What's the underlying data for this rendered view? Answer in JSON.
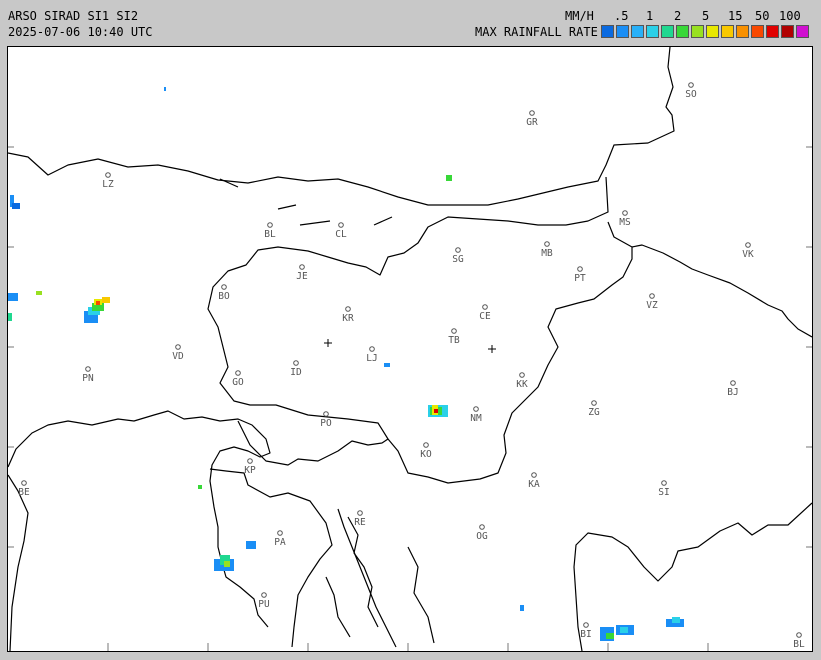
{
  "header": {
    "title": "ARSO SIRAD SI1 SI2",
    "timestamp": "2025-07-06 10:40 UTC",
    "units": "MM/H",
    "scale_title": "MAX RAINFALL RATE"
  },
  "scale": {
    "labels": [
      ".5",
      "1",
      "2",
      "5",
      "15",
      "50",
      "100"
    ],
    "colors": [
      "#0a6ae0",
      "#1a8ef5",
      "#28b0f8",
      "#2ad0e8",
      "#20d890",
      "#38d838",
      "#98e020",
      "#e8e800",
      "#f8c800",
      "#f89000",
      "#f84800",
      "#e00000",
      "#b00000",
      "#d010d0"
    ]
  },
  "cities": [
    {
      "name": "SO"
    },
    {
      "name": "GR"
    },
    {
      "name": "LZ"
    },
    {
      "name": "BL"
    },
    {
      "name": "CL"
    },
    {
      "name": "MS"
    },
    {
      "name": "MB"
    },
    {
      "name": "VK"
    },
    {
      "name": "SG"
    },
    {
      "name": "PT"
    },
    {
      "name": "JE"
    },
    {
      "name": "BO"
    },
    {
      "name": "KR"
    },
    {
      "name": "CE"
    },
    {
      "name": "VZ"
    },
    {
      "name": "TB"
    },
    {
      "name": "VD"
    },
    {
      "name": "LJ"
    },
    {
      "name": "PN"
    },
    {
      "name": "ID"
    },
    {
      "name": "GO"
    },
    {
      "name": "KK"
    },
    {
      "name": "BJ"
    },
    {
      "name": "ZG"
    },
    {
      "name": "PO"
    },
    {
      "name": "NM"
    },
    {
      "name": "KO"
    },
    {
      "name": "KP"
    },
    {
      "name": "KA"
    },
    {
      "name": "SI"
    },
    {
      "name": "BE"
    },
    {
      "name": "RE"
    },
    {
      "name": "PA"
    },
    {
      "name": "OG"
    },
    {
      "name": "PU"
    },
    {
      "name": "BI"
    },
    {
      "name": "BL"
    }
  ]
}
